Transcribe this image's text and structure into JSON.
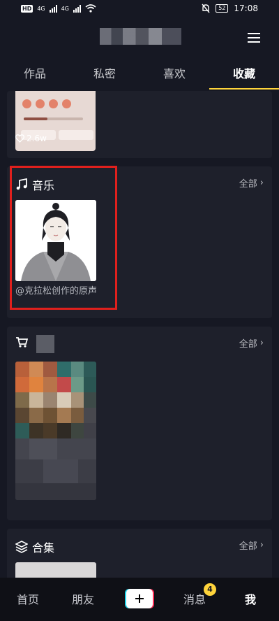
{
  "status_bar": {
    "left_chip": "HD",
    "signal_1": "4G",
    "signal_2": "4G",
    "battery": "52",
    "time": "17:08"
  },
  "tabs": [
    {
      "label": "作品"
    },
    {
      "label": "私密"
    },
    {
      "label": "喜欢"
    },
    {
      "label": "收藏",
      "active": true
    }
  ],
  "top_card": {
    "likes": "2.6w"
  },
  "music": {
    "title": "音乐",
    "more": "全部",
    "caption": "@克拉松创作的原声"
  },
  "shop": {
    "more": "全部"
  },
  "collection": {
    "title": "合集",
    "more": "全部"
  },
  "nav": {
    "home": "首页",
    "friends": "朋友",
    "messages": "消息",
    "messages_badge": "4",
    "me": "我"
  },
  "colors": {
    "accent": "#ffd43b",
    "highlight": "#e0201d",
    "background": "#161823"
  }
}
